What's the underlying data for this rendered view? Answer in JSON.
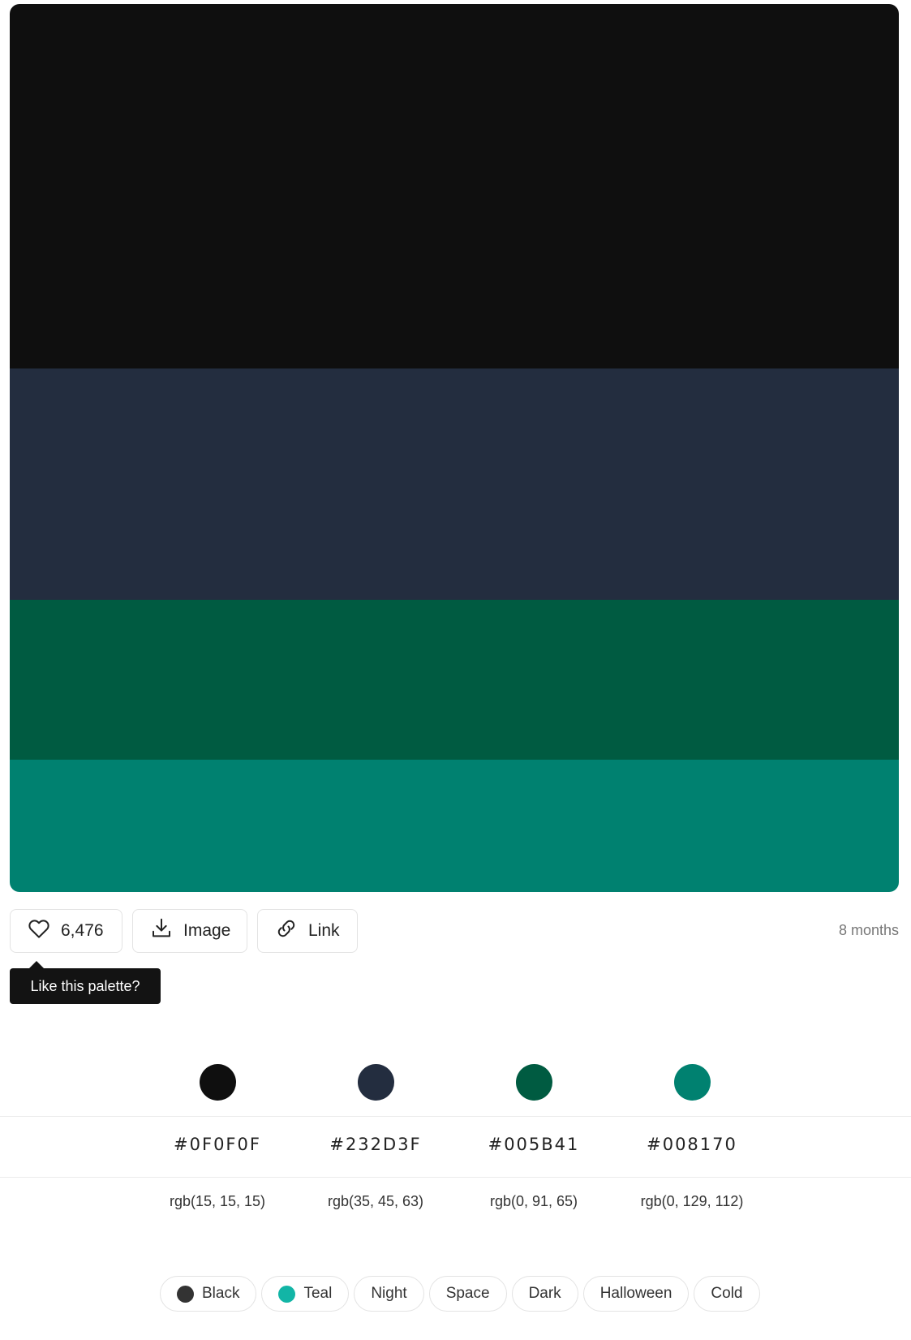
{
  "palette": {
    "stripes": [
      {
        "hex": "#0F0F0F"
      },
      {
        "hex": "#232D3F"
      },
      {
        "hex": "#005B41"
      },
      {
        "hex": "#008170"
      }
    ]
  },
  "actions": {
    "likes": "6,476",
    "image_label": "Image",
    "link_label": "Link",
    "time": "8 months"
  },
  "tooltip": {
    "text": "Like this palette?"
  },
  "colors": [
    {
      "hex": "#0F0F0F",
      "rgb": "rgb(15, 15, 15)"
    },
    {
      "hex": "#232D3F",
      "rgb": "rgb(35, 45, 63)"
    },
    {
      "hex": "#005B41",
      "rgb": "rgb(0, 91, 65)"
    },
    {
      "hex": "#008170",
      "rgb": "rgb(0, 129, 112)"
    }
  ],
  "tags": [
    {
      "label": "Black",
      "dot": "#333333"
    },
    {
      "label": "Teal",
      "dot": "#12B5A6"
    },
    {
      "label": "Night"
    },
    {
      "label": "Space"
    },
    {
      "label": "Dark"
    },
    {
      "label": "Halloween"
    },
    {
      "label": "Cold"
    }
  ],
  "icons": {
    "like": "heart-icon",
    "image": "download-icon",
    "link": "link-icon"
  }
}
